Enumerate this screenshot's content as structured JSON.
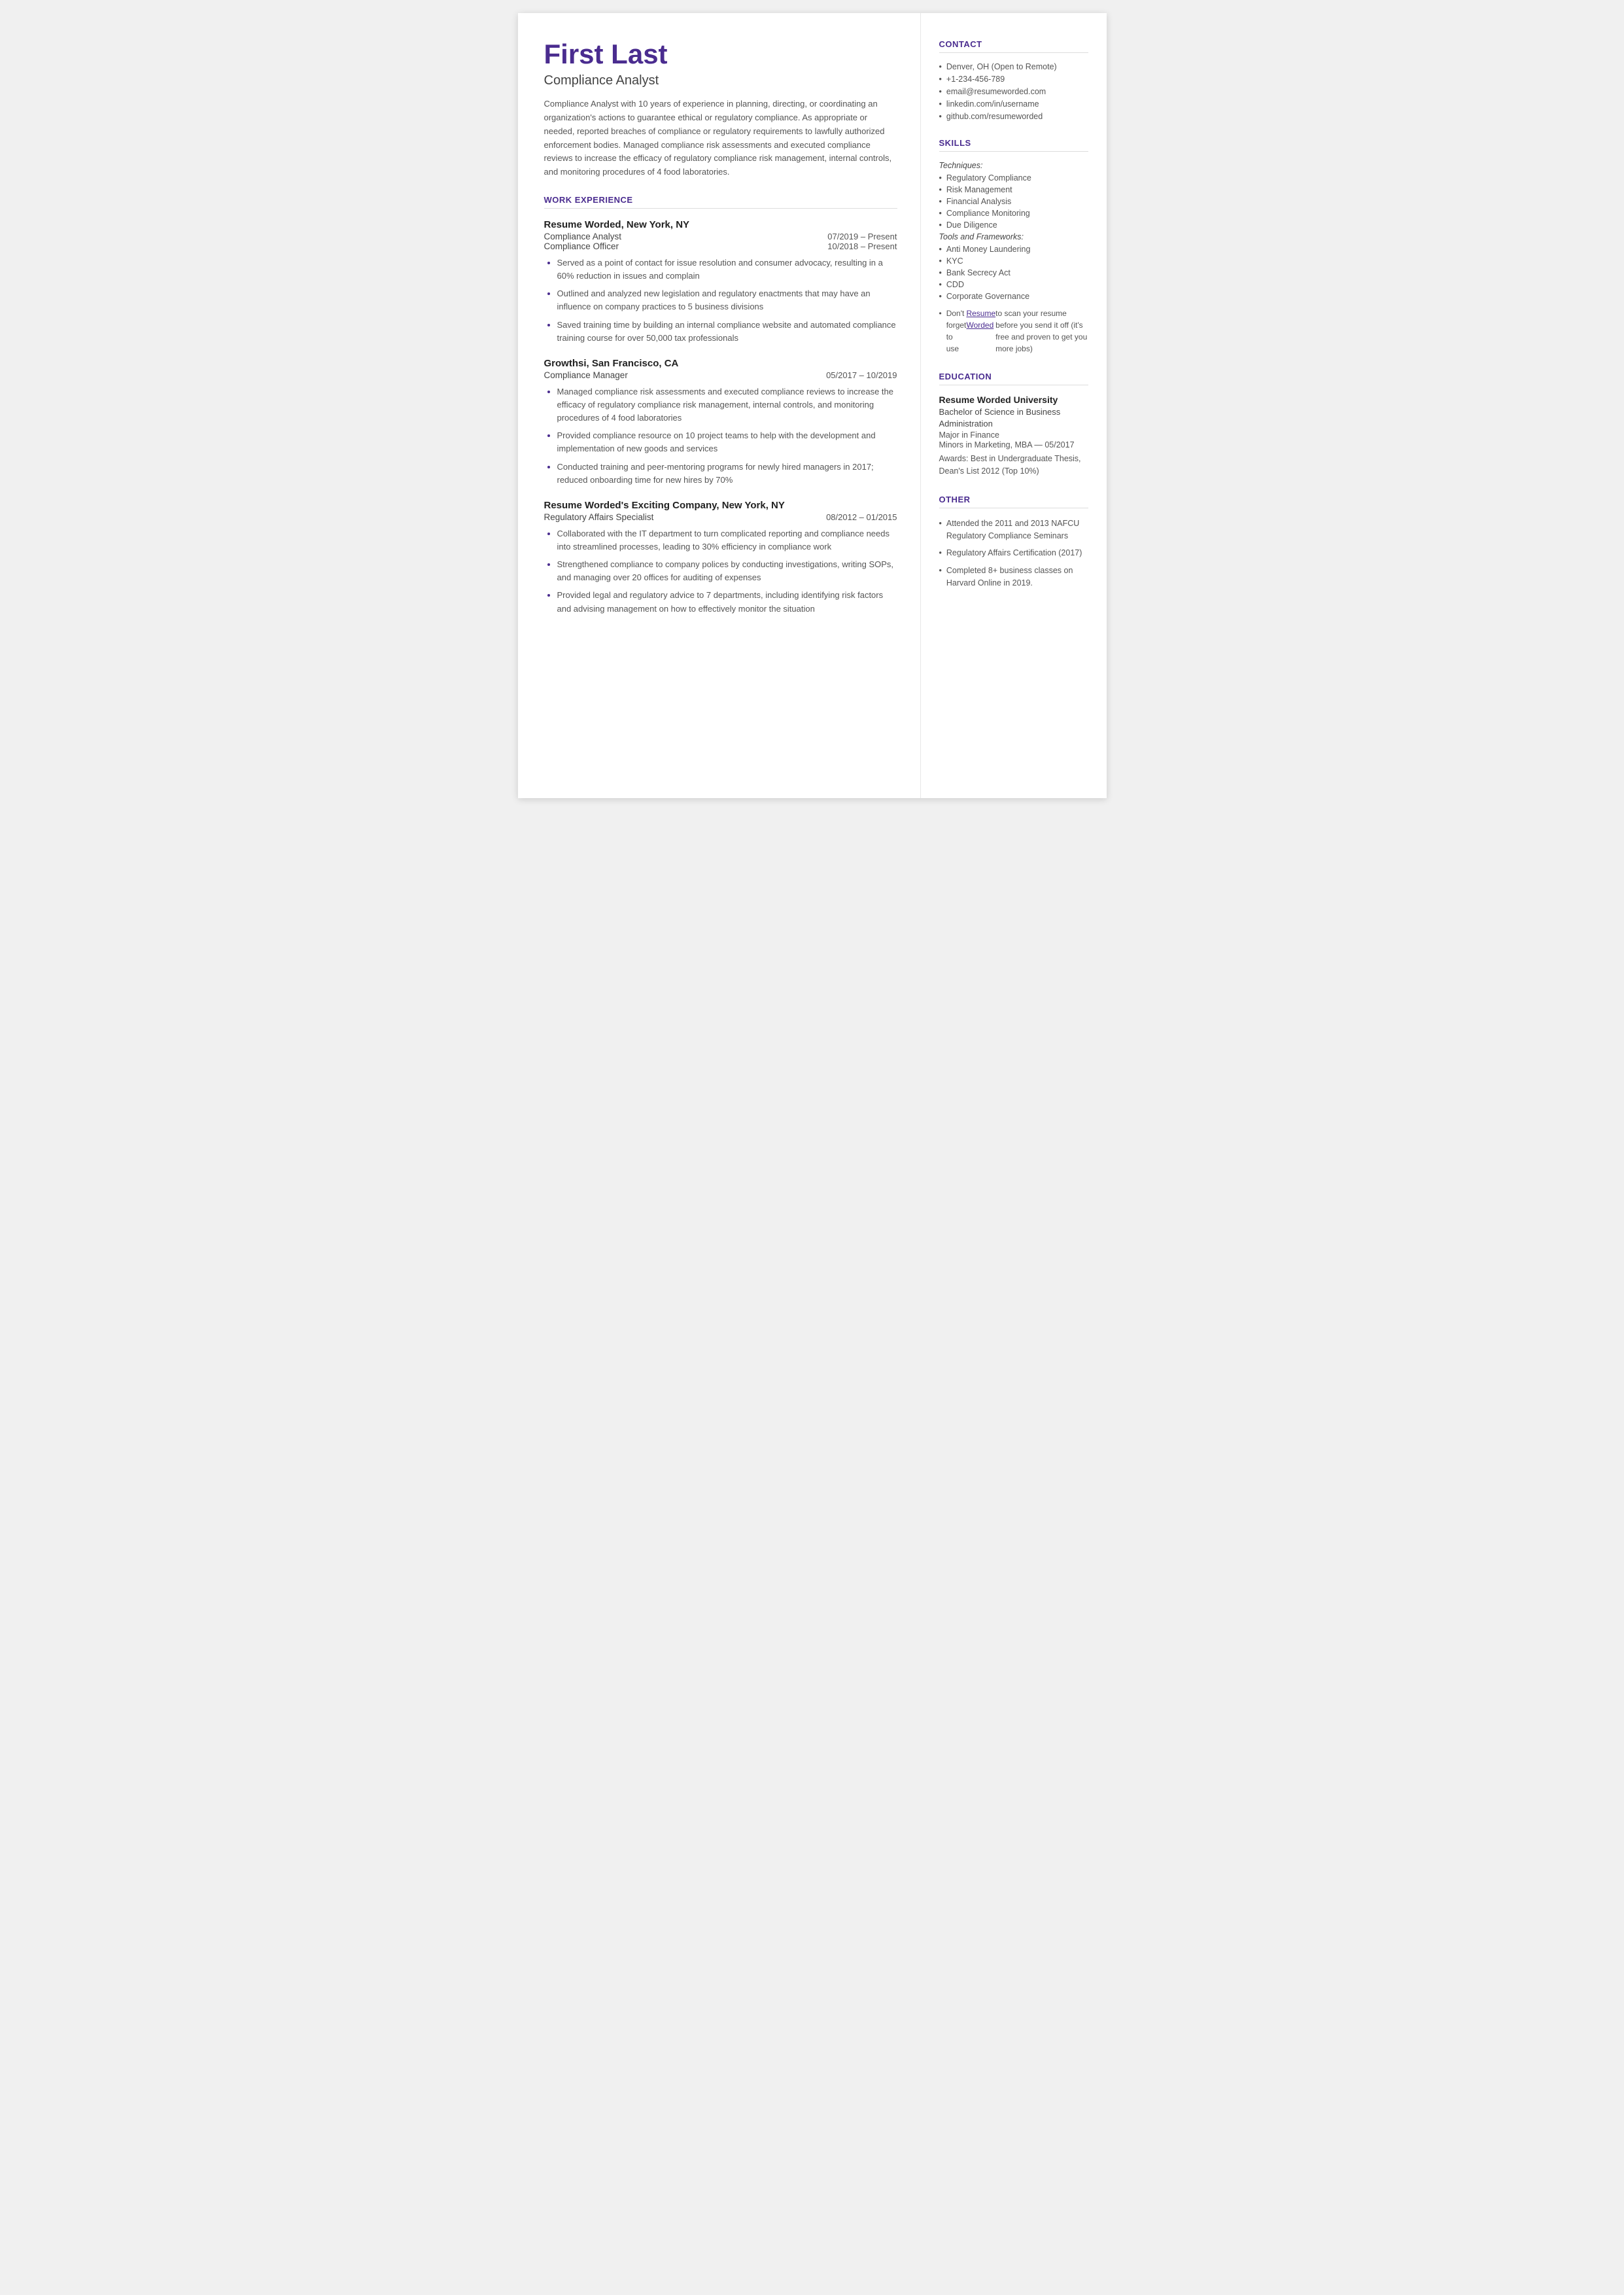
{
  "header": {
    "name": "First Last",
    "job_title": "Compliance Analyst",
    "summary": "Compliance Analyst with 10 years of experience in planning, directing, or coordinating an organization's actions to guarantee ethical or regulatory compliance. As appropriate or needed, reported breaches of compliance or regulatory requirements to lawfully authorized enforcement bodies. Managed compliance risk assessments and executed compliance reviews to increase the efficacy of regulatory compliance risk management, internal controls, and monitoring procedures of 4 food laboratories."
  },
  "work_experience": {
    "section_label": "WORK EXPERIENCE",
    "jobs": [
      {
        "company": "Resume Worded, New York, NY",
        "roles": [
          {
            "title": "Compliance Analyst",
            "dates": "07/2019 – Present"
          },
          {
            "title": "Compliance Officer",
            "dates": "10/2018 – Present"
          }
        ],
        "bullets": [
          "Served as a point of contact for issue resolution and consumer advocacy, resulting in a 60% reduction in issues and complain",
          "Outlined and analyzed new legislation and regulatory enactments that may have an influence on company practices to 5 business divisions",
          "Saved training time by building an internal compliance website and automated compliance training course for over 50,000 tax professionals"
        ]
      },
      {
        "company": "Growthsi, San Francisco, CA",
        "roles": [
          {
            "title": "Compliance Manager",
            "dates": "05/2017 – 10/2019"
          }
        ],
        "bullets": [
          "Managed compliance risk assessments and executed compliance reviews to increase the efficacy of regulatory compliance risk management, internal controls, and monitoring procedures of 4 food laboratories",
          "Provided compliance resource on 10 project teams to help with the development and implementation of new goods and services",
          "Conducted training and peer-mentoring programs for newly hired managers in 2017; reduced onboarding time for new hires by 70%"
        ]
      },
      {
        "company": "Resume Worded's Exciting Company, New York, NY",
        "roles": [
          {
            "title": "Regulatory Affairs Specialist",
            "dates": "08/2012 – 01/2015"
          }
        ],
        "bullets": [
          "Collaborated with the IT department to turn complicated reporting and compliance needs into streamlined processes, leading to 30% efficiency in compliance work",
          "Strengthened compliance to company polices by conducting investigations, writing SOPs, and managing over 20 offices for auditing of expenses",
          "Provided legal and regulatory advice to 7 departments, including identifying risk factors and advising management on how to effectively monitor the situation"
        ]
      }
    ]
  },
  "contact": {
    "section_label": "CONTACT",
    "items": [
      "Denver, OH (Open to Remote)",
      "+1-234-456-789",
      "email@resumeworded.com",
      "linkedin.com/in/username",
      "github.com/resumeworded"
    ]
  },
  "skills": {
    "section_label": "SKILLS",
    "techniques_label": "Techniques:",
    "techniques": [
      "Regulatory Compliance",
      "Risk Management",
      "Financial Analysis",
      "Compliance Monitoring",
      "Due Diligence"
    ],
    "tools_label": "Tools and Frameworks:",
    "tools": [
      "Anti Money Laundering",
      "KYC",
      "Bank Secrecy Act",
      "CDD",
      "Corporate Governance"
    ],
    "note_prefix": "Don't forget to use ",
    "note_link_text": "Resume Worded",
    "note_suffix": " to scan your resume before you send it off (it's free and proven to get you more jobs)"
  },
  "education": {
    "section_label": "EDUCATION",
    "school": "Resume Worded University",
    "degree": "Bachelor of Science in Business Administration",
    "major": "Major in Finance",
    "minors": "Minors in Marketing, MBA — 05/2017",
    "awards": "Awards: Best in Undergraduate Thesis, Dean's List 2012 (Top 10%)"
  },
  "other": {
    "section_label": "OTHER",
    "items": [
      "Attended the 2011 and 2013 NAFCU Regulatory Compliance Seminars",
      "Regulatory Affairs Certification (2017)",
      "Completed 8+ business classes on Harvard Online in 2019."
    ]
  }
}
